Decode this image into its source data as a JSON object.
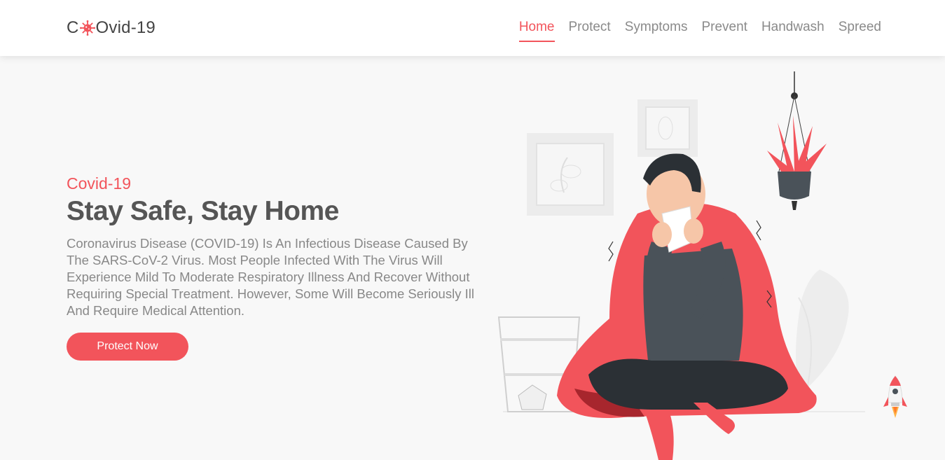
{
  "header": {
    "logo": {
      "prefix": "C",
      "suffix": "Ovid-19",
      "icon": "virus-icon"
    },
    "nav": [
      {
        "label": "Home",
        "active": true
      },
      {
        "label": "Protect",
        "active": false
      },
      {
        "label": "Symptoms",
        "active": false
      },
      {
        "label": "Prevent",
        "active": false
      },
      {
        "label": "Handwash",
        "active": false
      },
      {
        "label": "Spreed",
        "active": false
      }
    ]
  },
  "hero": {
    "subtitle": "Covid-19",
    "title": "Stay Safe, Stay Home",
    "description": "Coronavirus Disease (COVID-19) Is An Infectious Disease Caused By The SARS-CoV-2 Virus. Most People Infected With The Virus Will Experience Mild To Moderate Respiratory Illness And Recover Without Requiring Special Treatment. However, Some Will Become Seriously Ill And Require Medical Attention.",
    "cta_label": "Protect Now"
  },
  "illustration": {
    "icon": "sick-person-illustration"
  },
  "scroll_top": {
    "icon": "rocket-icon"
  },
  "colors": {
    "accent": "#f2545b",
    "text_dark": "#555555",
    "text_muted": "#888888",
    "background": "#f8f8f8"
  }
}
